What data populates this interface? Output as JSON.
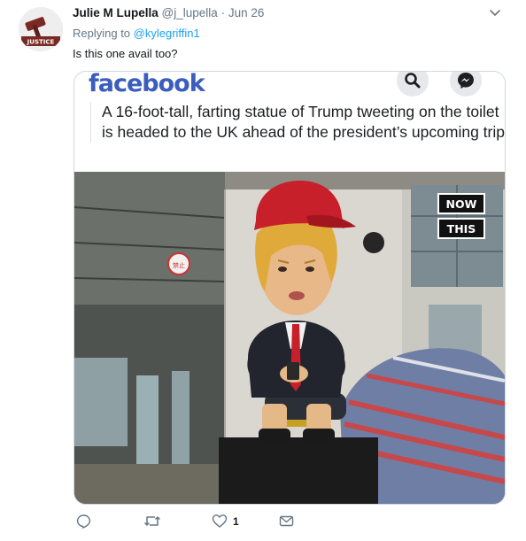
{
  "tweet": {
    "author_name": "Julie M Lupella",
    "author_handle": "@j_lupella",
    "separator": "·",
    "date": "Jun 26",
    "replying_prefix": "Replying to",
    "replying_mention": "@kylegriffin1",
    "text": "Is this one avail too?",
    "avatar_text": "JUSTICE",
    "stats": {
      "replies": "",
      "retweets": "",
      "likes": "1"
    }
  },
  "card": {
    "brand": "facebook",
    "headline": "A 16-foot-tall, farting statue of Trump tweeting on the toilet is headed to the UK ahead of the president’s upcoming trip",
    "badge_line1": "NOW",
    "badge_line2": "THIS",
    "sign_text": "禁止"
  },
  "icons": [
    "chevron-down-icon",
    "search-icon",
    "messenger-icon",
    "reply-icon",
    "retweet-icon",
    "like-icon",
    "share-icon"
  ],
  "colors": {
    "link": "#1da1f2",
    "secondary_text": "#657786",
    "facebook_blue": "#3b5ebd",
    "cap_red": "#c8202b"
  }
}
